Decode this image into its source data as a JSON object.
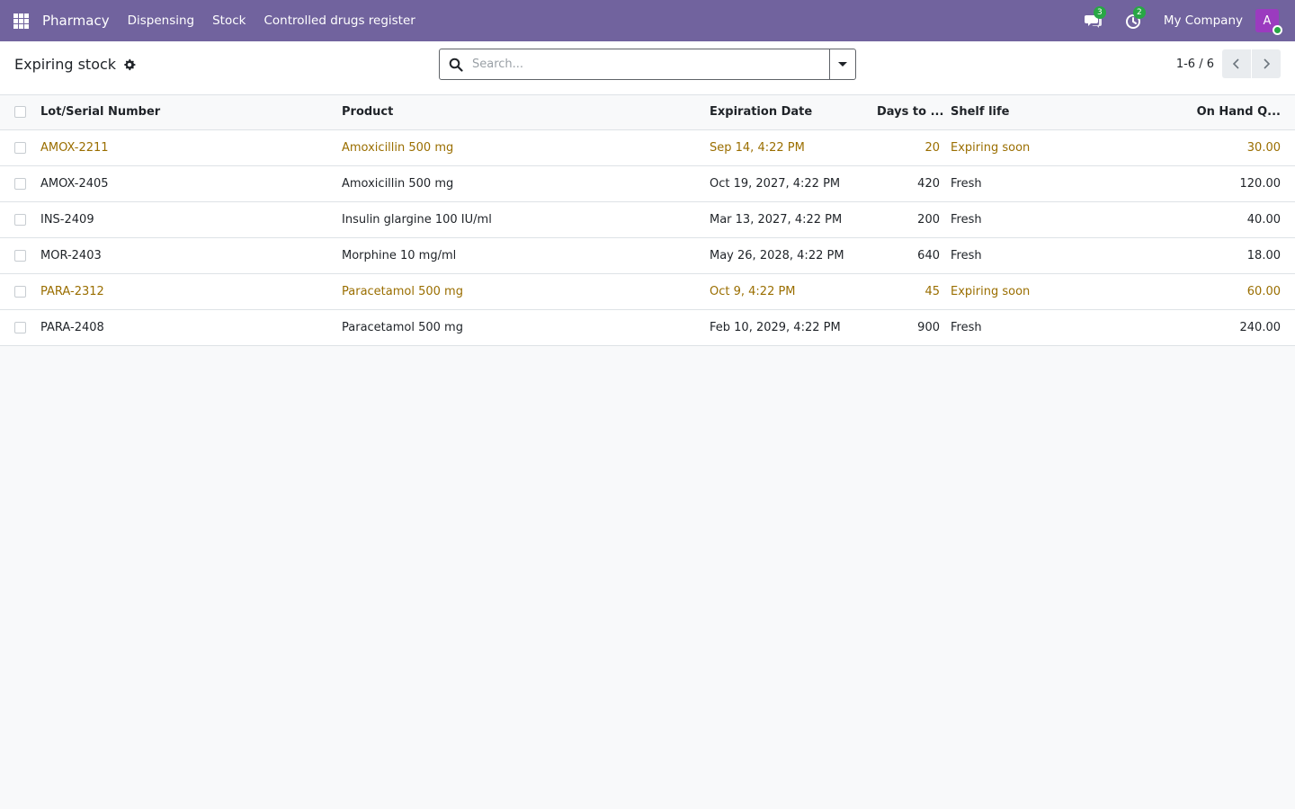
{
  "navbar": {
    "app_name": "Pharmacy",
    "menu": [
      "Dispensing",
      "Stock",
      "Controlled drugs register"
    ],
    "messages_badge": "3",
    "activities_badge": "2",
    "company": "My Company",
    "avatar_initial": "A"
  },
  "control_panel": {
    "title": "Expiring stock",
    "search_placeholder": "Search...",
    "pager_value": "1-6 / 6"
  },
  "table": {
    "columns": [
      "Lot/Serial Number",
      "Product",
      "Expiration Date",
      "Days to ...",
      "Shelf life",
      "On Hand Q..."
    ],
    "rows": [
      {
        "lot": "AMOX-2211",
        "product": "Amoxicillin 500 mg",
        "expiration": "Sep 14, 4:22 PM",
        "days": "20",
        "shelf_life": "Expiring soon",
        "qty": "30.00",
        "status": "warning"
      },
      {
        "lot": "AMOX-2405",
        "product": "Amoxicillin 500 mg",
        "expiration": "Oct 19, 2027, 4:22 PM",
        "days": "420",
        "shelf_life": "Fresh",
        "qty": "120.00",
        "status": "normal"
      },
      {
        "lot": "INS-2409",
        "product": "Insulin glargine 100 IU/ml",
        "expiration": "Mar 13, 2027, 4:22 PM",
        "days": "200",
        "shelf_life": "Fresh",
        "qty": "40.00",
        "status": "normal"
      },
      {
        "lot": "MOR-2403",
        "product": "Morphine 10 mg/ml",
        "expiration": "May 26, 2028, 4:22 PM",
        "days": "640",
        "shelf_life": "Fresh",
        "qty": "18.00",
        "status": "normal"
      },
      {
        "lot": "PARA-2312",
        "product": "Paracetamol 500 mg",
        "expiration": "Oct 9, 4:22 PM",
        "days": "45",
        "shelf_life": "Expiring soon",
        "qty": "60.00",
        "status": "warning"
      },
      {
        "lot": "PARA-2408",
        "product": "Paracetamol 500 mg",
        "expiration": "Feb 10, 2029, 4:22 PM",
        "days": "900",
        "shelf_life": "Fresh",
        "qty": "240.00",
        "status": "normal"
      }
    ]
  },
  "colors": {
    "navbar_bg": "#71639e",
    "warning_text": "#9a6e00",
    "badge_green": "#28a745",
    "avatar_bg": "#9b3bbf"
  },
  "icons": {
    "apps": "apps-grid-icon",
    "messages": "chat-bubbles-icon",
    "activities": "clock-icon",
    "settings": "gear-icon",
    "search": "search-icon",
    "toggle": "caret-down-icon",
    "prev": "chevron-left-icon",
    "next": "chevron-right-icon"
  }
}
